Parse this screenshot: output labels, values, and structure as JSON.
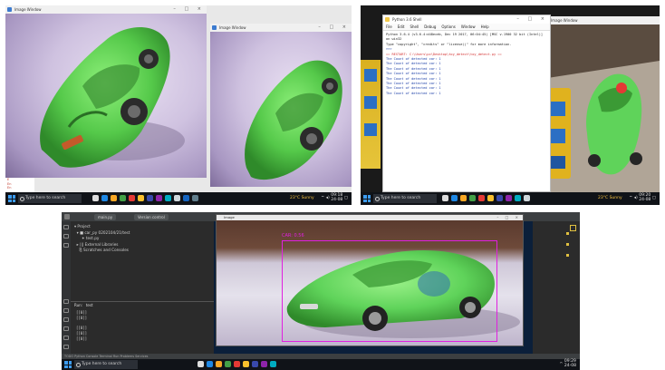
{
  "top_left": {
    "windows": [
      {
        "title": "Image Window",
        "controls": "– □ ×"
      },
      {
        "title": "Image Window",
        "controls": "– □ ×"
      }
    ],
    "side_text": "E\nEn\nEn",
    "taskbar": {
      "search_placeholder": "Type here to search",
      "weather": "23°C Sunny",
      "clock": "09:18\n24-08"
    }
  },
  "top_right": {
    "terminal": {
      "title": "Python 3.6 Shell",
      "controls": "– □ ×",
      "menu": [
        "File",
        "Edit",
        "Shell",
        "Debug",
        "Options",
        "Window",
        "Help"
      ],
      "lines": [
        "Python 3.6.4 (v3.6.4:d48eceb, Dec 19 2017, 06:04:45) [MSC v.1900 32 bit (Intel)]",
        "on win32",
        "Type \"copyright\", \"credits\" or \"license()\" for more information.",
        ">>>",
        "== RESTART: C:\\Users\\pc\\Desktop\\toy_detect\\toy_detect.py ==",
        "The Count of detected car: 1",
        "The Count of detected car: 1",
        "The Count of detected car: 1",
        "The Count of detected car: 1",
        "The Count of detected car: 1",
        "The Count of detected car: 1",
        "The Count of detected car: 1",
        "The Count of detected car: 1"
      ]
    },
    "camera_window": {
      "title": "Image Window"
    },
    "taskbar": {
      "search_placeholder": "Type here to search",
      "weather": "23°C Sunny",
      "clock": "09:20\n24-08"
    }
  },
  "bottom": {
    "ide_tabs": [
      "main.py",
      "Version control"
    ],
    "tree_lines": [
      "▾ Project",
      "  ▾ ■ car_py 0202104/21/test",
      "      ✦ test.py",
      "  ▸ ||| External Libraries",
      "    ⎘ Scratches and Consoles"
    ],
    "run_tab": "Run:   test",
    "run_lines": [
      "[[0]]",
      "[[0]]",
      "",
      "[[0]]",
      "[[0]]",
      "[[0]]"
    ],
    "status_line": "TODO   Python Console   Terminal   Run   Problems   Services",
    "detect_window": {
      "title": "Image",
      "controls": "– □ ×"
    },
    "detection_label": "CAR: 0.56",
    "taskbar": {
      "search_placeholder": "Type here to search",
      "clock": "09:29\n24-08"
    }
  },
  "colors": {
    "toy_green": "#5fd35a",
    "bbox": "#e020e0",
    "taskbar": "#101318",
    "terminal_text": "#1c3fa8"
  }
}
